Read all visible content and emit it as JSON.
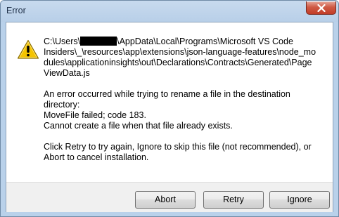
{
  "window": {
    "title": "Error",
    "close_icon": "close-icon"
  },
  "icon": {
    "name": "warning-icon",
    "color": "#f5c400"
  },
  "message": {
    "path_prefix": "C:\\Users\\",
    "path_suffix": "\\AppData\\Local\\Programs\\Microsoft VS Code",
    "path_line2": "Insiders\\_\\resources\\app\\extensions\\json-language-features\\node_mo",
    "path_line3": "dules\\applicationinsights\\out\\Declarations\\Contracts\\Generated\\Page",
    "path_line4": "ViewData.js",
    "error_line1": "An error occurred while trying to rename a file in the destination",
    "error_line2": "directory:",
    "error_line3": "MoveFile failed; code 183.",
    "error_line4": "Cannot create a file when that file already exists.",
    "help_line1": "Click Retry to try again, Ignore to skip this file (not recommended), or",
    "help_line2": "Abort to cancel installation."
  },
  "buttons": {
    "abort": "Abort",
    "retry": "Retry",
    "ignore": "Ignore"
  }
}
